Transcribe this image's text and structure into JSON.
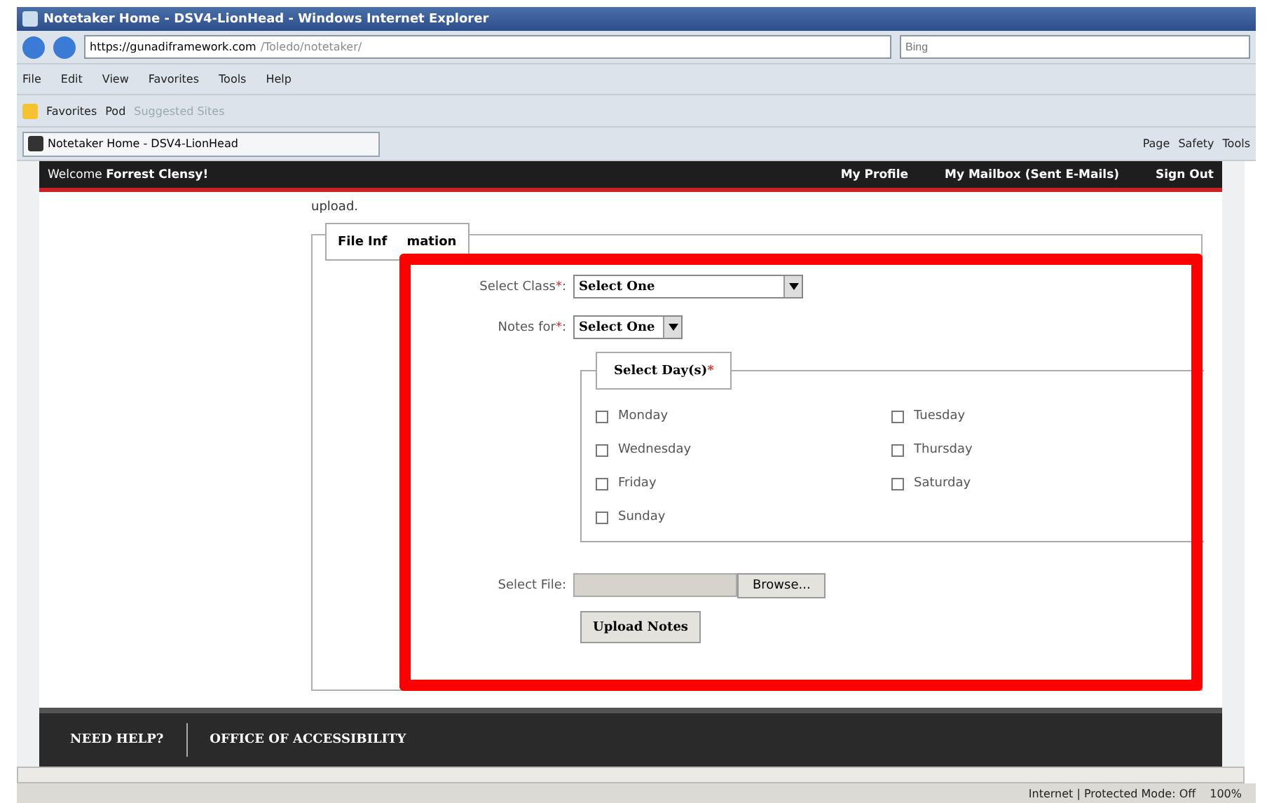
{
  "window": {
    "title": "Notetaker Home - DSV4-LionHead - Windows Internet Explorer"
  },
  "address": {
    "host": "https://gunadiframework.com",
    "path": "/Toledo/notetaker/"
  },
  "search": {
    "placeholder": "Bing"
  },
  "menu": [
    "File",
    "Edit",
    "View",
    "Favorites",
    "Tools",
    "Help"
  ],
  "favorites": {
    "label": "Favorites",
    "items": [
      {
        "label": "Pod",
        "disabled": false
      },
      {
        "label": "Suggested Sites",
        "disabled": true
      }
    ]
  },
  "tab": {
    "label": "Notetaker Home - DSV4-LionHead"
  },
  "command_bar": [
    "Page",
    "Safety",
    "Tools"
  ],
  "header": {
    "welcome": "Welcome ",
    "user": "Forrest Clensy!",
    "links": [
      "My Profile",
      "My Mailbox (Sent E-Mails)",
      "Sign Out"
    ]
  },
  "intro": "upload.",
  "fieldset": {
    "legend_visible_parts": [
      "File Inf",
      "mation"
    ]
  },
  "fields": [
    {
      "label": "Select Class",
      "value": "Select One",
      "kind": "wide"
    },
    {
      "label": "Notes for",
      "value": "Select One",
      "kind": "narrow"
    }
  ],
  "required_mark": "*",
  "label_suffix": ":",
  "days": {
    "legend": "Select Day(s)",
    "items": [
      {
        "label": "Monday",
        "checked": false
      },
      {
        "label": "Tuesday",
        "checked": false
      },
      {
        "label": "Wednesday",
        "checked": false
      },
      {
        "label": "Thursday",
        "checked": false
      },
      {
        "label": "Friday",
        "checked": false
      },
      {
        "label": "Saturday",
        "checked": false
      },
      {
        "label": "Sunday",
        "checked": false
      }
    ]
  },
  "file": {
    "label": "Select File:",
    "browse": "Browse..."
  },
  "upload_button": "Upload Notes",
  "footer": [
    "NEED HELP?",
    "OFFICE OF ACCESSIBILITY"
  ],
  "status": {
    "zone": "Internet | Protected Mode: Off",
    "zoom": "100%"
  }
}
